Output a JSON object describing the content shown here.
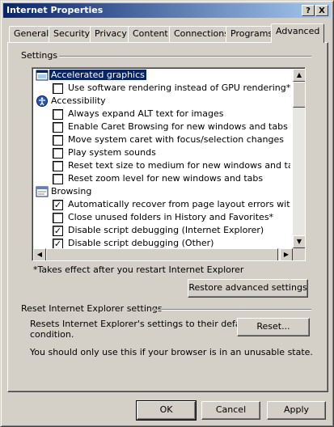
{
  "window": {
    "title": "Internet Properties",
    "help_glyph": "?",
    "close_glyph": "X"
  },
  "tabs": [
    {
      "label": "General"
    },
    {
      "label": "Security"
    },
    {
      "label": "Privacy"
    },
    {
      "label": "Content"
    },
    {
      "label": "Connections"
    },
    {
      "label": "Programs"
    },
    {
      "label": "Advanced",
      "active": true
    }
  ],
  "settings": {
    "group_label": "Settings",
    "rows": [
      {
        "type": "category",
        "icon": "display-icon",
        "label": "Accelerated graphics",
        "selected": true
      },
      {
        "type": "checkbox",
        "checked": false,
        "label": "Use software rendering instead of GPU rendering*"
      },
      {
        "type": "category",
        "icon": "accessibility-icon",
        "label": "Accessibility"
      },
      {
        "type": "checkbox",
        "checked": false,
        "label": "Always expand ALT text for images"
      },
      {
        "type": "checkbox",
        "checked": false,
        "label": "Enable Caret Browsing for new windows and tabs"
      },
      {
        "type": "checkbox",
        "checked": false,
        "label": "Move system caret with focus/selection changes"
      },
      {
        "type": "checkbox",
        "checked": false,
        "label": "Play system sounds"
      },
      {
        "type": "checkbox",
        "checked": false,
        "label": "Reset text size to medium for new windows and tabs"
      },
      {
        "type": "checkbox",
        "checked": false,
        "label": "Reset zoom level for new windows and tabs"
      },
      {
        "type": "category",
        "icon": "browsing-icon",
        "label": "Browsing"
      },
      {
        "type": "checkbox",
        "checked": true,
        "label": "Automatically recover from page layout errors with Compa"
      },
      {
        "type": "checkbox",
        "checked": false,
        "label": "Close unused folders in History and Favorites*"
      },
      {
        "type": "checkbox",
        "checked": true,
        "label": "Disable script debugging (Internet Explorer)"
      },
      {
        "type": "checkbox",
        "checked": true,
        "label": "Disable script debugging (Other)"
      }
    ],
    "footnote": "*Takes effect after you restart Internet Explorer",
    "restore_button": "Restore advanced settings",
    "check_glyph": "✓"
  },
  "reset": {
    "group_label": "Reset Internet Explorer settings",
    "description_line1": "Resets Internet Explorer's settings to their default",
    "description_line2": "condition.",
    "button": "Reset...",
    "note": "You should only use this if your browser is in an unusable state."
  },
  "footer": {
    "ok": "OK",
    "cancel": "Cancel",
    "apply": "Apply"
  },
  "colors": {
    "selection": "#0a246a",
    "titlebar_start": "#0a246a",
    "titlebar_end": "#a6caf0",
    "face": "#d4d0c8"
  }
}
